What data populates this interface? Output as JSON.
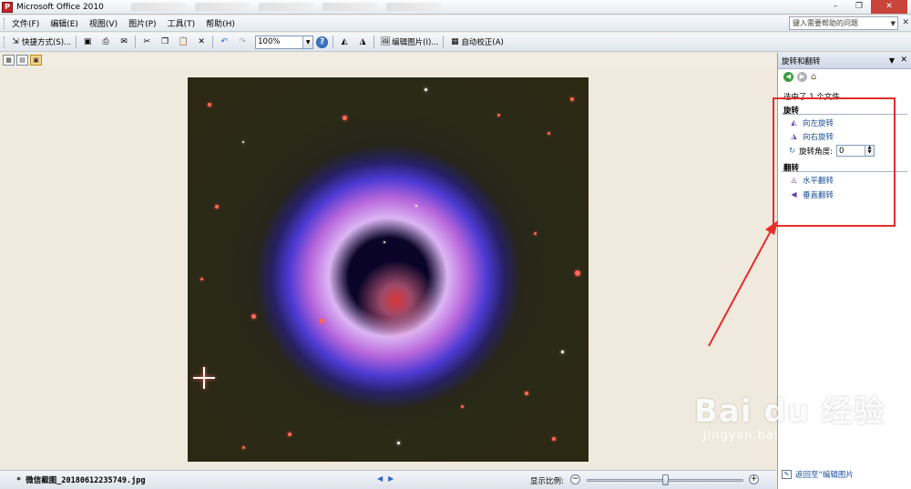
{
  "window": {
    "title": "Microsoft Office 2010",
    "controls": [
      "–",
      "❐",
      "✕"
    ]
  },
  "menu": {
    "items": [
      "文件(F)",
      "编辑(E)",
      "视图(V)",
      "图片(P)",
      "工具(T)",
      "帮助(H)"
    ],
    "help_placeholder": "键入需要帮助的问题"
  },
  "toolbar": {
    "shortcuts_label": "快捷方式(S)...",
    "zoom_value": "100%",
    "edit_picture_label": "编辑图片(I)...",
    "auto_correct_label": "自动校正(A)"
  },
  "task_pane": {
    "title": "旋转和翻转",
    "selection_count": "选中了 1 个文件",
    "rotate_section": "旋转",
    "rotate_left": "向左旋转",
    "rotate_right": "向右旋转",
    "rotate_angle_label": "旋转角度:",
    "rotate_angle_value": "0",
    "flip_section": "翻转",
    "flip_horizontal": "水平翻转",
    "flip_vertical": "垂直翻转",
    "back_link": "返回至“编辑图片"
  },
  "status": {
    "file_name": "* 微信截图_20180612235749.jpg",
    "zoom_label": "显示比例:",
    "zoom_slider_fraction": 0.5
  },
  "watermark": {
    "logo": "Bai  du 经验",
    "url": "jingyan.baidu.com"
  },
  "colors": {
    "annotation": "#e82c2c",
    "link": "#1a4f9a"
  }
}
